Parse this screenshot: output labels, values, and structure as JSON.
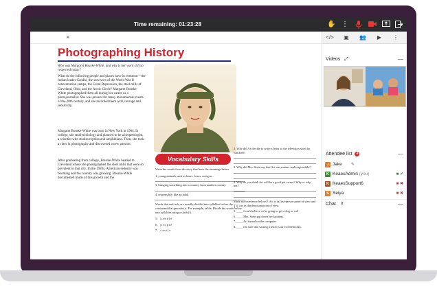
{
  "topbar": {
    "timer": "Time remaining: 01:23:28"
  },
  "document": {
    "close_label": "×",
    "title": "Photographing History",
    "intro": "Who was Margaret Bourke-White, and why is her work still so respected today?",
    "paragraphs": [
      "What do the following people and places have in common—the Indian leader Gandhi, the survivors of the World War II concentration camps, the Great Depression, the steel mills of Cleveland, Ohio, and the Arctic Circle? Margaret Bourke-White photographed them all during her career as a photojournalist. She was present for many monumental events of the 20th century, and she recorded them with courage and sensitivity.",
      "Margaret Bourke-White was born in New York in 1904. In college, she studied biology and planned to be a herpetologist, a scientist who studies reptiles and amphibians. Then, she took a class in photography and discovered a new passion.",
      "After graduating from college, Bourke-White headed to Cleveland where she photographed the steel mills that were so prevalent in that city. In the 1920s, American industry was booming and the country was growing. Bourke-White documented much of this growth and the"
    ],
    "vocab_banner": "Vocabulary Skills",
    "vocab_intro": "Write the words from the story that have the meanings below.",
    "vocab_items": [
      "1. young animals such as bears, foxes, or tigers",
      "3. bringing something into a country from another country",
      "4. responsible; like an adult"
    ],
    "syllable_text": "Words that end in le are usually divided into syllables before the consonant that precedes it. For example, ta/ble. Divide the words below into syllables using a slash (/).",
    "syllable_words": [
      "5. handle",
      "6. people",
      "7. castle"
    ],
    "right_questions": [
      "2. Why did Ari decide to write a letter to the television show he watched?",
      "3. Why did Mrs. Stein say that Ari was mature and responsible?",
      "4. Why do you think Ari will be a good pet owner? Why or why not?"
    ],
    "pov_text": "Mark each sentence below F if it is in first-person point of view and T if it is in third-person point of view.",
    "pov_items": [
      "5. ____ I can't believe we're going to get a dog or cat!",
      "6. ____ Mrs. Stein put down her knitting.",
      "7. ____ Ari turned on the computer.",
      "8. ____ I'm sure that writing a letter is an excellent idea."
    ]
  },
  "panel": {
    "videos_label": "Videos",
    "attendee_label": "Attendee list",
    "attendee_count": "4",
    "chat_label": "Chat",
    "attendees": [
      {
        "initial": "J",
        "name": "Jake",
        "color": "#e07b2a"
      },
      {
        "initial": "K",
        "name": "KeaesAdmin",
        "suffix": "(you)",
        "color": "#3a8a3a"
      },
      {
        "initial": "K",
        "name": "KeaesSupport6",
        "color": "#a0522d"
      },
      {
        "initial": "S",
        "name": "Seiya",
        "color": "#e07b2a"
      }
    ]
  },
  "colors": {
    "accent": "#d3232c",
    "frame": "#3a1f3a",
    "topbar": "#2b2b2e"
  }
}
